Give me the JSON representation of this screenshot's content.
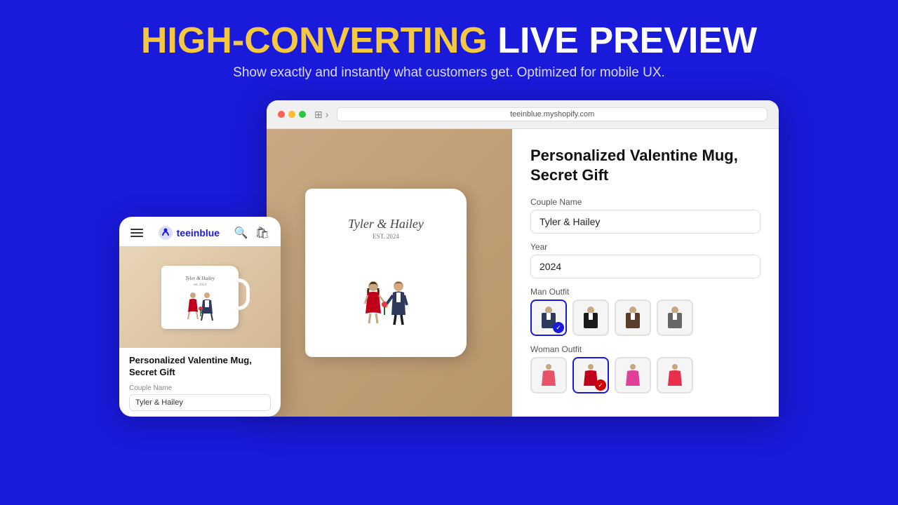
{
  "header": {
    "title_highlight": "HIGH-CONVERTING",
    "title_rest": " LIVE PREVIEW",
    "subtitle": "Show exactly and instantly what customers get. Optimized for mobile UX."
  },
  "mobile_card": {
    "brand_name": "teeinblue",
    "product_title": "Personalized Valentine Mug, Secret Gift",
    "couple_name_label": "Couple Name",
    "couple_name_value": "Tyler & Hailey",
    "mug_text": "Tyler & Hailey",
    "mug_subtext": "est. 2024"
  },
  "desktop_card": {
    "url": "teeinblue.myshopify.com",
    "product_title": "Personalized Valentine Mug, Secret Gift",
    "mug_text": "Tyler & Hailey",
    "mug_subtext": "EST. 2024",
    "fields": {
      "couple_name_label": "Couple Name",
      "couple_name_value": "Tyler & Hailey",
      "year_label": "Year",
      "year_value": "2024",
      "man_outfit_label": "Man Outfit",
      "woman_outfit_label": "Woman Outfit"
    },
    "man_outfits": [
      {
        "id": "navy",
        "label": "Navy suit",
        "selected": true
      },
      {
        "id": "black",
        "label": "Black suit",
        "selected": false
      },
      {
        "id": "brown",
        "label": "Brown suit",
        "selected": false
      },
      {
        "id": "gray",
        "label": "Gray suit",
        "selected": false
      }
    ],
    "woman_outfits": [
      {
        "id": "pink",
        "label": "Pink dress",
        "selected": false
      },
      {
        "id": "red",
        "label": "Red dress",
        "selected": true
      },
      {
        "id": "hotpink",
        "label": "Hot pink dress",
        "selected": false
      },
      {
        "id": "coral",
        "label": "Coral dress",
        "selected": false
      }
    ]
  }
}
